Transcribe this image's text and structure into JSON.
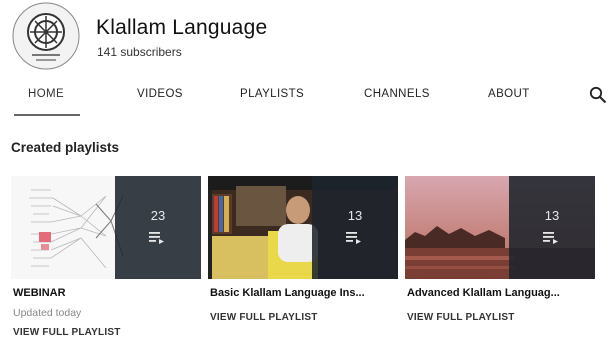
{
  "channel": {
    "name": "Klallam Language",
    "subscribers": "141 subscribers",
    "avatar_icon": "tribal-seal-logo"
  },
  "tabs": [
    {
      "label": "HOME",
      "active": true
    },
    {
      "label": "VIDEOS",
      "active": false
    },
    {
      "label": "PLAYLISTS",
      "active": false
    },
    {
      "label": "CHANNELS",
      "active": false
    },
    {
      "label": "ABOUT",
      "active": false
    }
  ],
  "search_icon": "search-icon",
  "section": {
    "title": "Created playlists"
  },
  "playlists": [
    {
      "title": "WEBINAR",
      "count": "23",
      "updated": "Updated today",
      "link": "VIEW FULL PLAYLIST"
    },
    {
      "title": "Basic Klallam Language Ins...",
      "count": "13",
      "link": "VIEW FULL PLAYLIST"
    },
    {
      "title": "Advanced Klallam Languag...",
      "count": "13",
      "link": "VIEW FULL PLAYLIST"
    }
  ],
  "colors": {
    "overlay": "#1e242c",
    "text": "#111111",
    "muted": "#888888"
  }
}
